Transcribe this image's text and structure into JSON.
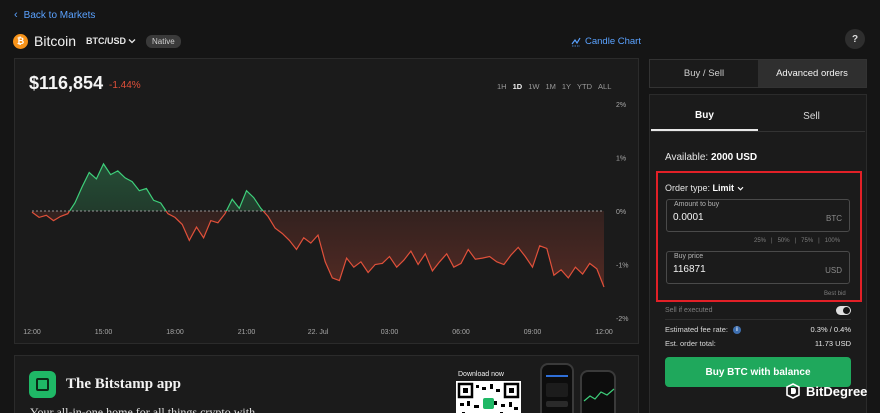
{
  "nav": {
    "back_label": "Back to Markets"
  },
  "asset": {
    "icon_symbol": "₿",
    "name": "Bitcoin",
    "pair": "BTC/USD",
    "badge": "Native"
  },
  "header": {
    "chart_toggle_label": "Candle Chart",
    "help_label": "?"
  },
  "chart": {
    "price": "$116,854",
    "change": "-1.44%",
    "ranges": [
      "1H",
      "1D",
      "1W",
      "1M",
      "1Y",
      "YTD",
      "ALL"
    ],
    "active_range": "1D",
    "y_ticks": [
      "2%",
      "1%",
      "0%",
      "-1%",
      "-2%"
    ],
    "x_ticks": [
      "12:00",
      "15:00",
      "18:00",
      "21:00",
      "22. Jul",
      "03:00",
      "06:00",
      "09:00",
      "12:00"
    ],
    "colors": {
      "up": "#3ecf7a",
      "down": "#e0503a"
    }
  },
  "chart_data": {
    "type": "line",
    "title": "",
    "xlabel": "",
    "ylabel": "",
    "x_ticks": [
      "12:00",
      "15:00",
      "18:00",
      "21:00",
      "22. Jul",
      "03:00",
      "06:00",
      "09:00",
      "12:00"
    ],
    "y_ticks": [
      "2%",
      "1%",
      "0%",
      "-1%",
      "-2%"
    ],
    "ylim": [
      -2,
      2
    ],
    "baseline": 0,
    "x_hours": [
      0,
      0.3,
      0.6,
      0.9,
      1.2,
      1.5,
      1.8,
      2.1,
      2.4,
      2.7,
      3.0,
      3.3,
      3.6,
      3.9,
      4.2,
      4.5,
      4.8,
      5.1,
      5.4,
      5.7,
      6.0,
      6.3,
      6.6,
      6.9,
      7.2,
      7.5,
      7.8,
      8.1,
      8.4,
      8.7,
      9.0,
      9.3,
      9.6,
      9.9,
      10.2,
      10.5,
      10.8,
      11.1,
      11.4,
      11.7,
      12.0,
      12.3,
      12.6,
      12.9,
      13.2,
      13.5,
      13.8,
      14.1,
      14.4,
      14.7,
      15.0,
      15.3,
      15.6,
      15.9,
      16.2,
      16.5,
      16.8,
      17.1,
      17.4,
      17.7,
      18.0,
      18.3,
      18.6,
      18.9,
      19.2,
      19.5,
      19.8,
      20.1,
      20.4,
      20.7,
      21.0,
      21.3,
      21.6,
      21.9,
      22.2,
      22.5,
      22.8,
      23.1,
      23.4,
      23.7,
      24.0
    ],
    "values": [
      -0.02,
      -0.12,
      -0.08,
      -0.18,
      -0.1,
      -0.05,
      0.15,
      0.45,
      0.72,
      0.6,
      0.88,
      0.68,
      0.75,
      0.62,
      0.55,
      0.38,
      0.42,
      0.2,
      0.15,
      -0.05,
      -0.12,
      -0.25,
      -0.55,
      -0.3,
      -0.5,
      -0.18,
      -0.22,
      -0.05,
      0.22,
      0.05,
      0.38,
      0.25,
      0.05,
      -0.1,
      -0.32,
      -0.42,
      -0.55,
      -0.72,
      -0.5,
      -0.6,
      -0.45,
      -0.95,
      -1.25,
      -1.3,
      -0.88,
      -1.05,
      -0.95,
      -1.15,
      -1.0,
      -0.98,
      -0.85,
      -1.05,
      -0.92,
      -0.75,
      -1.0,
      -0.8,
      -1.12,
      -0.95,
      -0.8,
      -1.05,
      -0.98,
      -0.72,
      -0.9,
      -0.88,
      -0.85,
      -0.95,
      -1.0,
      -0.82,
      -0.68,
      -0.85,
      -1.05,
      -0.65,
      -0.7,
      -1.2,
      -1.1,
      -1.25,
      -1.05,
      -1.18,
      -0.98,
      -1.08,
      -1.42
    ]
  },
  "promo": {
    "title": "The Bitstamp app",
    "subtitle": "Your all-in-one home for all things crypto with",
    "download_label": "Download now"
  },
  "order": {
    "tabs": [
      "Buy / Sell",
      "Advanced orders"
    ],
    "active_tab": "Advanced orders",
    "side_tabs": [
      "Buy",
      "Sell"
    ],
    "active_side": "Buy",
    "available_label": "Available:",
    "available_value": "2000 USD",
    "order_type_label": "Order type:",
    "order_type_value": "Limit",
    "amount": {
      "label": "Amount to buy",
      "value": "0.0001",
      "unit": "BTC"
    },
    "percents": [
      "25%",
      "50%",
      "75%",
      "100%"
    ],
    "buy_price": {
      "label": "Buy price",
      "value": "116871",
      "unit": "USD"
    },
    "best_bid_label": "Best bid",
    "sell_if_executed_label": "Sell if executed",
    "sell_if_executed_on": true,
    "fee": {
      "label": "Estimated fee rate:",
      "value": "0.3% / 0.4%"
    },
    "total": {
      "label": "Est. order total:",
      "value": "11.73 USD"
    },
    "submit_label": "Buy BTC with balance",
    "colors": {
      "accent": "#1fa85c",
      "highlight": "#e22027"
    }
  },
  "watermark": {
    "text": "BitDegree"
  }
}
